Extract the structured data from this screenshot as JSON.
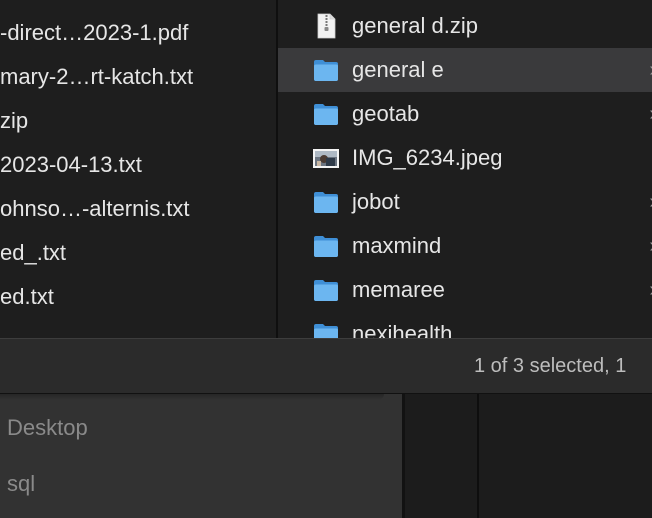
{
  "left_column": {
    "items": [
      {
        "label": "-direct…2023-1.pdf"
      },
      {
        "label": "mary-2…rt-katch.txt"
      },
      {
        "label": "zip"
      },
      {
        "label": "2023-04-13.txt"
      },
      {
        "label": "ohnso…-alternis.txt"
      },
      {
        "label": "ed_.txt"
      },
      {
        "label": "ed.txt"
      }
    ]
  },
  "right_column": {
    "items": [
      {
        "label": "general d.zip",
        "icon": "zip-file-icon",
        "has_children": false,
        "selected": false
      },
      {
        "label": "general e",
        "icon": "folder-icon",
        "has_children": true,
        "selected": true
      },
      {
        "label": "geotab",
        "icon": "folder-icon",
        "has_children": true,
        "selected": false
      },
      {
        "label": "IMG_6234.jpeg",
        "icon": "image-file-icon",
        "has_children": false,
        "selected": false
      },
      {
        "label": "jobot",
        "icon": "folder-icon",
        "has_children": true,
        "selected": false
      },
      {
        "label": "maxmind",
        "icon": "folder-icon",
        "has_children": true,
        "selected": false
      },
      {
        "label": "memaree",
        "icon": "folder-icon",
        "has_children": true,
        "selected": false
      },
      {
        "label": "nexihealth",
        "icon": "folder-icon",
        "has_children": true,
        "selected": false
      }
    ],
    "chevron": "›"
  },
  "status_bar": {
    "text": "1 of 3 selected, 1"
  },
  "sidebar": {
    "items": [
      {
        "label": "Desktop"
      },
      {
        "label": "sql"
      }
    ]
  },
  "colors": {
    "folder_blue": "#5aa9e6",
    "selection_bg": "#3a3a3c",
    "text": "#e6e6e6"
  }
}
